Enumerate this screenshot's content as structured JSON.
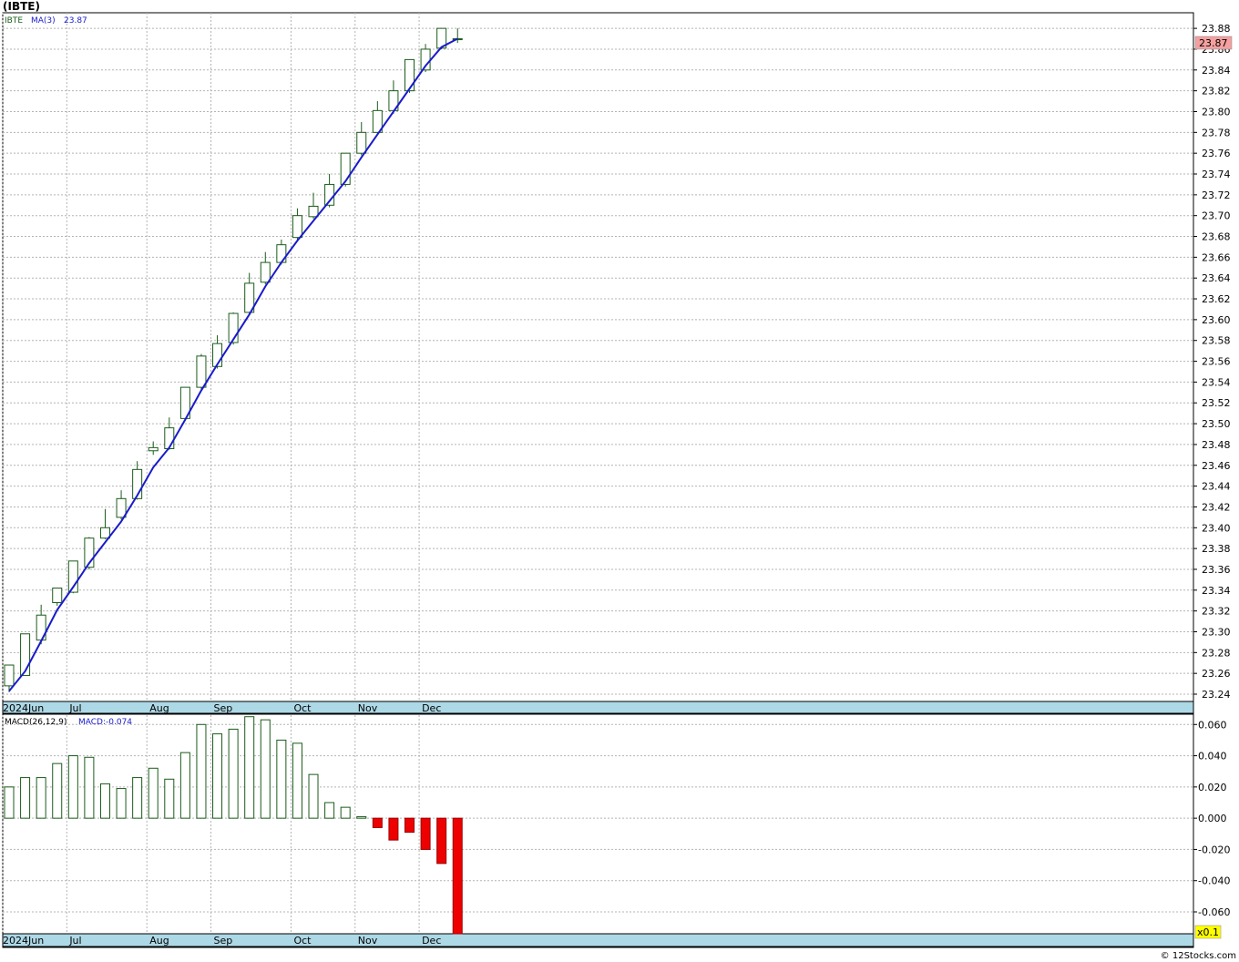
{
  "title": "(IBTE)",
  "footer": "© 12Stocks.com",
  "colors": {
    "up_candle": "#1a5c1a",
    "ma_line": "#1a1acc",
    "macd_pos": "#1a5c1a",
    "macd_neg": "#ee0000",
    "axis_band": "#add8e6",
    "last_price_bg": "#f4a0a0",
    "scale_badge_bg": "#ffff00"
  },
  "price_panel": {
    "legend_symbol": "IBTE",
    "legend_ma": "MA(3)",
    "legend_ma_value": "23.87",
    "last_price_label": "23.87"
  },
  "macd_panel": {
    "legend_name": "MACD(26,12,9)",
    "legend_value": "MACD:-0.074",
    "scale_badge": "x0.1"
  },
  "chart_data": [
    {
      "type": "candlestick",
      "title": "(IBTE)",
      "x_tick_labels": [
        "2024Jun",
        "Jul",
        "Aug",
        "Sep",
        "Oct",
        "Nov",
        "Dec"
      ],
      "x_tick_index": [
        0,
        4,
        9,
        13,
        18,
        22,
        26
      ],
      "ylim": [
        23.233,
        23.895
      ],
      "y_ticks": [
        23.24,
        23.26,
        23.28,
        23.3,
        23.32,
        23.34,
        23.36,
        23.38,
        23.4,
        23.42,
        23.44,
        23.46,
        23.48,
        23.5,
        23.52,
        23.54,
        23.56,
        23.58,
        23.6,
        23.62,
        23.64,
        23.66,
        23.68,
        23.7,
        23.72,
        23.74,
        23.76,
        23.78,
        23.8,
        23.82,
        23.84,
        23.86,
        23.88
      ],
      "y_tick_labels": [
        "23.24",
        "23.26",
        "23.28",
        "23.30",
        "23.32",
        "23.34",
        "23.36",
        "23.38",
        "23.40",
        "23.42",
        "23.44",
        "23.46",
        "23.48",
        "23.50",
        "23.52",
        "23.54",
        "23.56",
        "23.58",
        "23.60",
        "23.62",
        "23.64",
        "23.66",
        "23.68",
        "23.70",
        "23.72",
        "23.74",
        "23.76",
        "23.78",
        "23.80",
        "23.82",
        "23.84",
        "23.86",
        "23.88"
      ],
      "grid": true,
      "candles": [
        {
          "o": 23.248,
          "h": 23.268,
          "l": 23.242,
          "c": 23.268
        },
        {
          "o": 23.258,
          "h": 23.298,
          "l": 23.258,
          "c": 23.298
        },
        {
          "o": 23.292,
          "h": 23.326,
          "l": 23.288,
          "c": 23.316
        },
        {
          "o": 23.328,
          "h": 23.342,
          "l": 23.325,
          "c": 23.342
        },
        {
          "o": 23.338,
          "h": 23.368,
          "l": 23.337,
          "c": 23.368
        },
        {
          "o": 23.362,
          "h": 23.391,
          "l": 23.36,
          "c": 23.39
        },
        {
          "o": 23.39,
          "h": 23.418,
          "l": 23.389,
          "c": 23.4
        },
        {
          "o": 23.41,
          "h": 23.436,
          "l": 23.408,
          "c": 23.428
        },
        {
          "o": 23.428,
          "h": 23.464,
          "l": 23.427,
          "c": 23.456
        },
        {
          "o": 23.474,
          "h": 23.483,
          "l": 23.47,
          "c": 23.477
        },
        {
          "o": 23.476,
          "h": 23.506,
          "l": 23.475,
          "c": 23.496
        },
        {
          "o": 23.505,
          "h": 23.535,
          "l": 23.503,
          "c": 23.535
        },
        {
          "o": 23.535,
          "h": 23.567,
          "l": 23.533,
          "c": 23.565
        },
        {
          "o": 23.555,
          "h": 23.585,
          "l": 23.553,
          "c": 23.577
        },
        {
          "o": 23.578,
          "h": 23.607,
          "l": 23.576,
          "c": 23.606
        },
        {
          "o": 23.607,
          "h": 23.645,
          "l": 23.605,
          "c": 23.635
        },
        {
          "o": 23.636,
          "h": 23.665,
          "l": 23.634,
          "c": 23.655
        },
        {
          "o": 23.655,
          "h": 23.677,
          "l": 23.653,
          "c": 23.672
        },
        {
          "o": 23.679,
          "h": 23.707,
          "l": 23.676,
          "c": 23.7
        },
        {
          "o": 23.699,
          "h": 23.722,
          "l": 23.697,
          "c": 23.709
        },
        {
          "o": 23.71,
          "h": 23.74,
          "l": 23.708,
          "c": 23.73
        },
        {
          "o": 23.73,
          "h": 23.76,
          "l": 23.728,
          "c": 23.76
        },
        {
          "o": 23.76,
          "h": 23.79,
          "l": 23.758,
          "c": 23.78
        },
        {
          "o": 23.78,
          "h": 23.81,
          "l": 23.778,
          "c": 23.801
        },
        {
          "o": 23.801,
          "h": 23.83,
          "l": 23.798,
          "c": 23.82
        },
        {
          "o": 23.82,
          "h": 23.85,
          "l": 23.818,
          "c": 23.85
        },
        {
          "o": 23.84,
          "h": 23.865,
          "l": 23.838,
          "c": 23.86
        },
        {
          "o": 23.861,
          "h": 23.88,
          "l": 23.86,
          "c": 23.88
        },
        {
          "o": 23.87,
          "h": 23.88,
          "l": 23.866,
          "c": 23.87
        }
      ],
      "ma_series": {
        "name": "MA(3)",
        "values": [
          23.243,
          23.262,
          23.291,
          23.321,
          23.343,
          23.366,
          23.386,
          23.406,
          23.431,
          23.458,
          23.477,
          23.504,
          23.532,
          23.557,
          23.581,
          23.605,
          23.632,
          23.655,
          23.676,
          23.695,
          23.714,
          23.733,
          23.756,
          23.778,
          23.8,
          23.822,
          23.844,
          23.862,
          23.87
        ]
      }
    },
    {
      "type": "bar",
      "title": "MACD(26,12,9)",
      "ylim": [
        -0.074,
        0.066
      ],
      "y_ticks": [
        -0.06,
        -0.04,
        -0.02,
        0.0,
        0.02,
        0.04,
        0.06
      ],
      "y_tick_labels": [
        "-0.060",
        "-0.040",
        "-0.020",
        "0.000",
        "0.020",
        "0.040",
        "0.060"
      ],
      "x_tick_labels": [
        "2024Jun",
        "Jul",
        "Aug",
        "Sep",
        "Oct",
        "Nov",
        "Dec"
      ],
      "grid": true,
      "values": [
        0.02,
        0.026,
        0.026,
        0.035,
        0.04,
        0.039,
        0.022,
        0.019,
        0.026,
        0.032,
        0.025,
        0.042,
        0.06,
        0.054,
        0.057,
        0.065,
        0.063,
        0.05,
        0.048,
        0.028,
        0.01,
        0.007,
        0.001,
        -0.006,
        -0.014,
        -0.009,
        -0.02,
        -0.029,
        -0.074
      ]
    }
  ]
}
